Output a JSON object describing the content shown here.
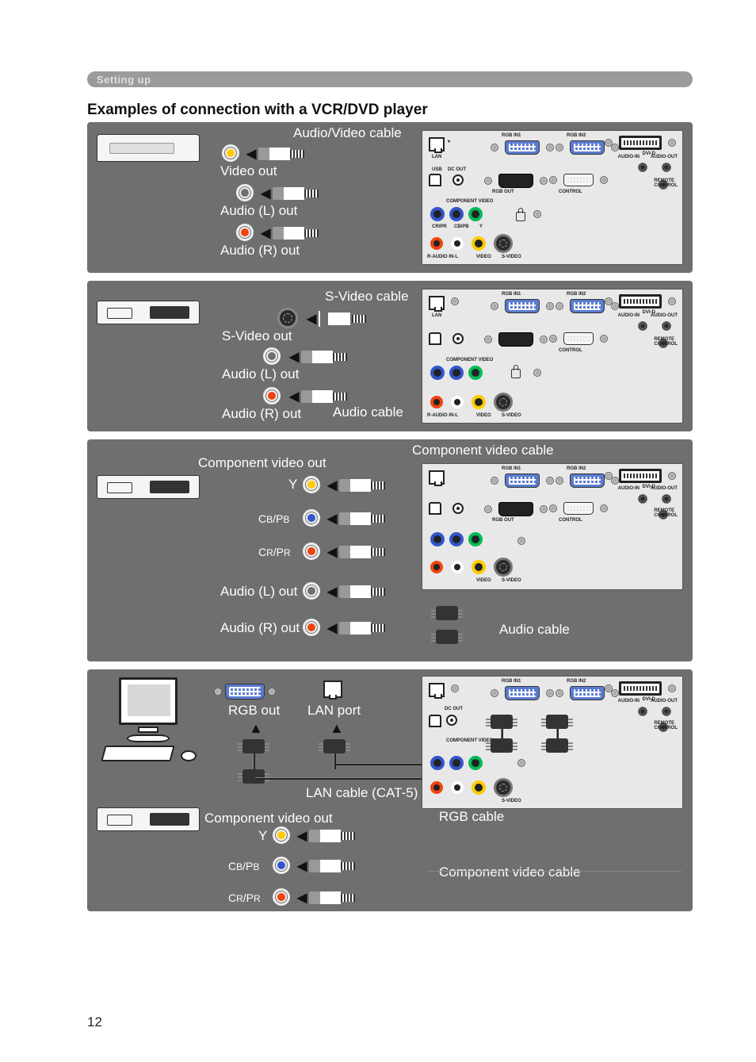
{
  "tab_title": "Setting up",
  "heading": "Examples of connection with a VCR/DVD player",
  "sec1": {
    "cable": "Audio/Video cable",
    "out1": "Video out",
    "out2": "Audio (L) out",
    "out3": "Audio (R) out"
  },
  "sec2": {
    "cable1": "S-Video cable",
    "cable2": "Audio cable",
    "out1": "S-Video out",
    "out2": "Audio (L) out",
    "out3": "Audio (R) out"
  },
  "sec3": {
    "title_l": "Component video out",
    "cable1": "Component video cable",
    "cable2": "Audio cable",
    "y": "Y",
    "cbpb": "CB/PB",
    "crpr": "CR/PR",
    "al": "Audio (L) out",
    "ar": "Audio (R) out"
  },
  "sec4": {
    "rgb_out": "RGB out",
    "lan_port": "LAN port",
    "lan_cable": "LAN cable (CAT-5)",
    "rgb_cable": "RGB cable",
    "comp_out": "Component video out",
    "comp_cable": "Component video cable",
    "y": "Y",
    "cbpb": "CB/PB",
    "crpr": "CR/PR"
  },
  "panel": {
    "rgb_in1": "RGB IN1",
    "rgb_in2": "RGB IN2",
    "dvi_d": "DVI-D",
    "audio_in": "AUDIO-IN",
    "audio_out": "AUDIO-OUT",
    "remote": "REMOTE\nCONTROL",
    "lan": "LAN",
    "usb": "USB",
    "dc_out": "DC OUT",
    "comp_vid": "COMPONENT VIDEO",
    "rgb_out": "RGB OUT",
    "control": "CONTROL",
    "r_audio_l": "R-AUDIO IN-L",
    "video": "VIDEO",
    "svideo": "S-VIDEO",
    "y": "Y",
    "cbpb": "CB/PB",
    "crpr": "CR/PR"
  },
  "page": "12"
}
